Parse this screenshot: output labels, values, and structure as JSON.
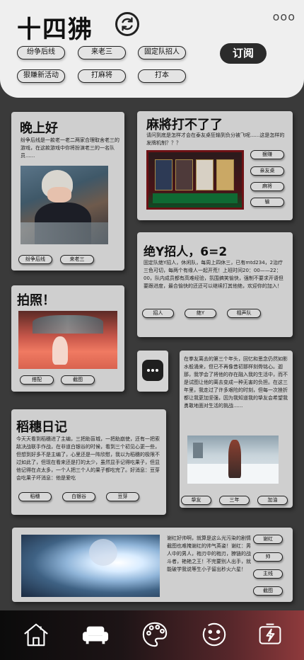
{
  "header": {
    "title": "十四狒",
    "subscribe_label": "订阅",
    "more_label": "ooo",
    "chips": [
      "纷争后线",
      "来老三",
      "固定队招人",
      "狠賺新活动",
      "打麻将",
      "打本"
    ]
  },
  "cards": {
    "evening": {
      "title": "晚上好",
      "text": "纷争后线是一款老一老二两家合理取舍老三的游戏，在这款游戏中你将扮演老三的一名队员......",
      "tags": [
        "纷争后线",
        "来老三"
      ]
    },
    "mahjong": {
      "title": "麻將打不了了",
      "text": "请问到底是怎样才会在泰友桌狂输到负分被飞呢......这是怎样的发牌机制？？？",
      "tags": [
        "狠赚",
        "亲友桌",
        "麻将",
        "输"
      ]
    },
    "recruit": {
      "title": "绝Y招人，6=2",
      "text": "固定队绝Y招人，休闲队，每周上四休三，已有mtd234，2治疗三色可切，每两个有缘人一起开荒！上班时间20：00——22：00，队内成员都有高难经验，氛围搞笑愉快，强制不要求开语但要跟进度，最合愉快的还还可以继续打其他绝，欢迎你的加入！",
      "tags": [
        "招人",
        "绝Y",
        "相声队"
      ]
    },
    "photo": {
      "title": "拍照！",
      "tags": [
        "搭配",
        "截图"
      ]
    },
    "menu": {
      "icon": "more-dots-icon"
    },
    "story": {
      "text": "在拳友离去的第三个年头，回忆和思念仍然如影水般涌来，但已不再像昔初那样刻骨铭心。迦那，我学会了将他的存在融入我的生活中，而不是试图让他的离去变成一种无害的负担。在这三年里，我走过了许多艰险的时刻，但每一次挫折都让我更加坚强，因为我知道我的挚友会希望我勇敢地面对生活的挑战......",
      "tags": [
        "挚友",
        "三年",
        "加油"
      ]
    },
    "diary": {
      "title": "稻穗日记",
      "text": "今天天看到稻穗进了主编，三把助盲城，一把助崩使，还有一把索敌决战联手作战，在非道白银谷的时候，看到三个初见心更一些，但想到好多不是主编了，心里还是一阵欣慰，我以为稻穗的极限不过如此了，但现在看来还是打的太少，虽然显手记得吃果子，但显他记得在点太多，一个人把三个人的果子都吃完了。好消息：豆芽会吃果子坏消息：他是爱吃",
      "tags": [
        "稻穗",
        "白银谷",
        "豆芽"
      ]
    },
    "shot": {
      "text": "谢红好帅啊，就算是这么光污染的剧情截图也难掩谢红的帅气英姿！谢红：男人中的男人，袍刃中的袍刃，獠链的战斗者，艳艳之王！不完要别人出手，就能破学我说等生小子留出秒火六星！",
      "tags": [
        "谢红",
        "帅",
        "主线",
        "截图"
      ]
    }
  },
  "nav": [
    {
      "icon": "home-icon"
    },
    {
      "icon": "sofa-icon"
    },
    {
      "icon": "palette-icon"
    },
    {
      "icon": "smile-icon"
    },
    {
      "icon": "battery-charge-icon"
    }
  ],
  "colors": {
    "background": "#3a3a3a",
    "card": "#cfcfcf",
    "header": "#efefef",
    "nav_gradient_end": "#8e3a3c"
  }
}
